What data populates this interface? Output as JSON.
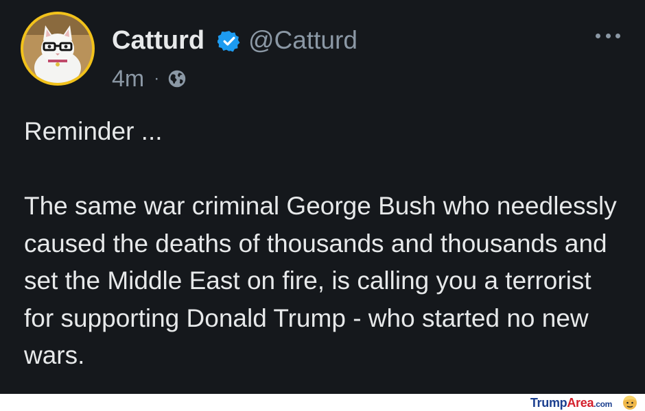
{
  "tweet": {
    "display_name": "Catturd",
    "handle": "@Catturd",
    "timestamp": "4m",
    "separator": "·",
    "verified_icon": "verified-badge-icon",
    "visibility_icon": "globe-icon",
    "more_icon": "more-options-icon",
    "body": {
      "line1": "Reminder ...",
      "paragraph2": "The same war criminal George Bush who needlessly caused the deaths of thousands and thousands and set the Middle East on fire, is calling you a terrorist for supporting Donald Trump - who started no new wars."
    }
  },
  "watermark": {
    "brand_part1": "Trump",
    "brand_part2": "Area",
    "brand_suffix": ".com"
  },
  "colors": {
    "background": "#15181c",
    "text_primary": "#e7e9ea",
    "text_secondary": "#8b98a5",
    "verified_blue": "#1d9bf0",
    "avatar_ring": "#f2c21b"
  }
}
